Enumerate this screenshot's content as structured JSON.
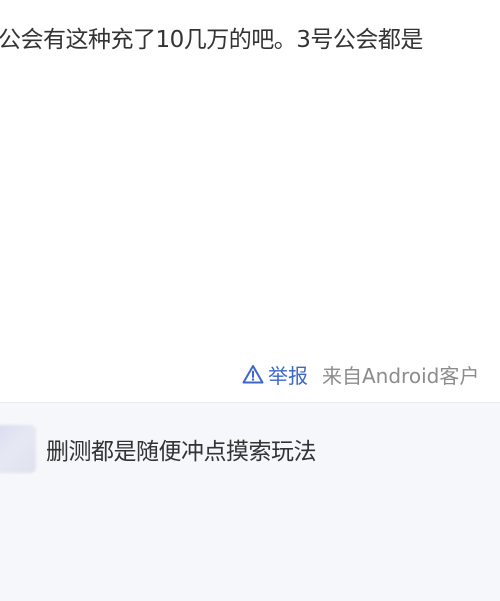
{
  "post": {
    "text": "公会有这种充了10几万的吧。3号公会都是",
    "report_label": "举报",
    "source_label": "来自Android客户"
  },
  "reply": {
    "text": "删测都是随便冲点摸索玩法"
  },
  "colors": {
    "link_blue": "#3d67c9",
    "meta_gray": "#8c8c8c",
    "reply_bg": "#f6f7fa"
  }
}
